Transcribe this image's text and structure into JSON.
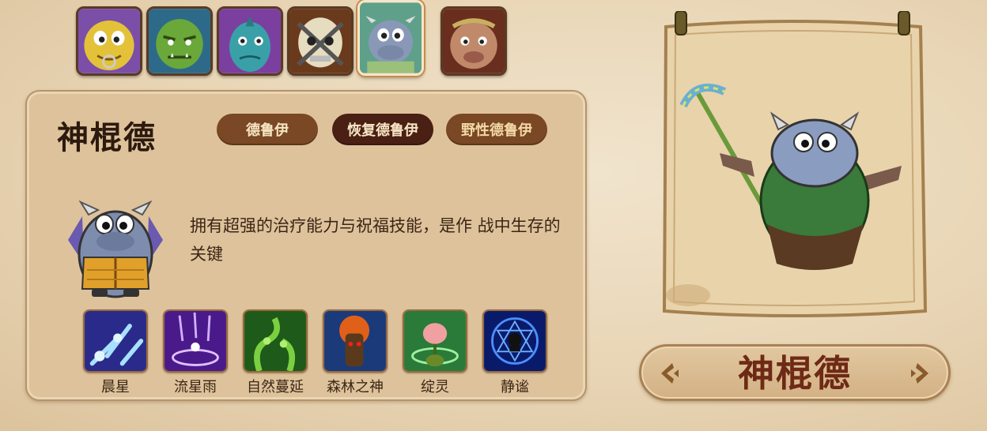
{
  "hero_strip": {
    "heroes": [
      {
        "icon": "yellow-ogre-hero-icon",
        "color": "#7b4fa8"
      },
      {
        "icon": "green-orc-hero-icon",
        "color": "#2d6a8a"
      },
      {
        "icon": "fish-warrior-hero-icon",
        "color": "#7b3fa0"
      },
      {
        "icon": "bandaged-skull-hero-icon",
        "color": "#6a3a1c"
      },
      {
        "icon": "hippo-druid-hero-icon",
        "color": "#5fa08a",
        "selected": true
      },
      {
        "icon": "brown-bull-hero-icon",
        "color": "#6a2e1e"
      }
    ]
  },
  "hero": {
    "name": "神棍德",
    "tags": [
      "德鲁伊",
      "恢复德鲁伊",
      "野性德鲁伊"
    ],
    "description": "拥有超强的治疗能力与祝福技能，是作 战中生存的关键",
    "portrait_icon": "hippo-druid-portrait-icon"
  },
  "skills": [
    {
      "name": "晨星",
      "icon": "morning-star-skill-icon"
    },
    {
      "name": "流星雨",
      "icon": "meteor-shower-skill-icon"
    },
    {
      "name": "自然蔓延",
      "icon": "nature-vines-skill-icon"
    },
    {
      "name": "森林之神",
      "icon": "forest-god-skill-icon"
    },
    {
      "name": "绽灵",
      "icon": "bloom-spirit-skill-icon"
    },
    {
      "name": "静谧",
      "icon": "tranquility-skill-icon"
    }
  ],
  "showcase": {
    "name": "神棍德",
    "prev_icon": "chevron-left-icon",
    "next_icon": "chevron-right-icon"
  },
  "colors": {
    "background": "#e8d5b5",
    "panel": "#dec29b",
    "tag_brown": "#7a4824",
    "tag_dark": "#4a1f14",
    "name_red": "#6e2a16"
  }
}
